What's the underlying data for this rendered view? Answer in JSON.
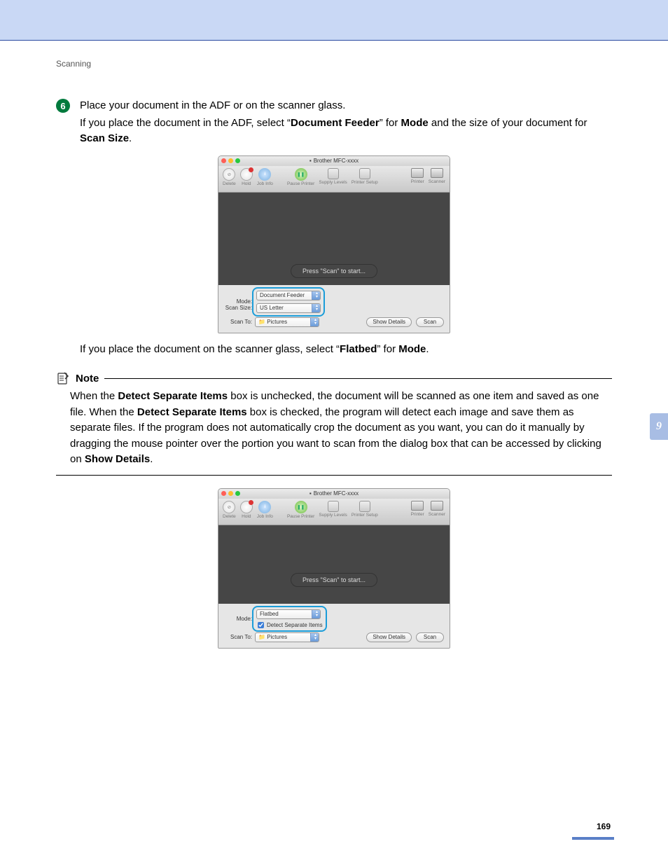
{
  "header": {
    "section_title": "Scanning"
  },
  "step": {
    "number": "6",
    "line1": "Place your document in the ADF or on the scanner glass.",
    "line2_a": "If you place the document in the ADF, select “",
    "line2_b": "Document Feeder",
    "line2_c": "” for ",
    "line2_d": "Mode",
    "line2_e": " and the size of your document for ",
    "line2_f": "Scan Size",
    "line2_g": "."
  },
  "window1": {
    "title": "Brother MFC-xxxx",
    "toolbar": {
      "delete": "Delete",
      "hold": "Hold",
      "jobinfo": "Job Info",
      "pause": "Pause Printer",
      "supply": "Supply Levels",
      "psetup": "Printer Setup",
      "printer": "Printer",
      "scanner": "Scanner"
    },
    "preview_msg": "Press \"Scan\" to start...",
    "labels": {
      "mode": "Mode:",
      "scansize": "Scan Size:",
      "scanto": "Scan To:"
    },
    "values": {
      "mode": "Document Feeder",
      "scansize": "US Letter",
      "scanto": "Pictures"
    },
    "buttons": {
      "details": "Show Details",
      "scan": "Scan"
    }
  },
  "mid_text": {
    "a": "If you place the document on the scanner glass, select “",
    "b": "Flatbed",
    "c": "” for ",
    "d": "Mode",
    "e": "."
  },
  "note": {
    "title": "Note",
    "t1": "When the ",
    "b1": "Detect Separate Items",
    "t2": " box is unchecked, the document will be scanned as one item and saved as one file. When the ",
    "b2": "Detect Separate Items",
    "t3": " box is checked, the program will detect each image and save them as separate files. If the program does not automatically crop the document as you want, you can do it manually by dragging the mouse pointer over the portion you want to scan from the dialog box that can be accessed by clicking on ",
    "b3": "Show Details",
    "t4": "."
  },
  "window2": {
    "title": "Brother MFC-xxxx",
    "preview_msg": "Press \"Scan\" to start...",
    "labels": {
      "mode": "Mode:",
      "detect": "Detect Separate Items",
      "scanto": "Scan To:"
    },
    "values": {
      "mode": "Flatbed",
      "scanto": "Pictures"
    },
    "buttons": {
      "details": "Show Details",
      "scan": "Scan"
    }
  },
  "chapter": "9",
  "page_number": "169"
}
